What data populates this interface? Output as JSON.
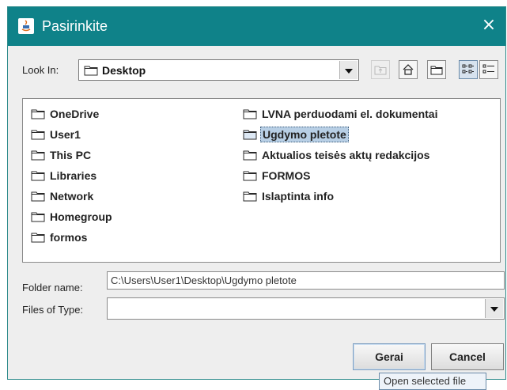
{
  "window": {
    "title": "Pasirinkite",
    "close_glyph": "×"
  },
  "look_in": {
    "label": "Look In:",
    "value": "Desktop"
  },
  "toolbar": {
    "icons": [
      "up-folder-icon",
      "home-icon",
      "new-folder-icon",
      "list-view-icon",
      "details-view-icon"
    ]
  },
  "files": [
    {
      "name": "OneDrive",
      "selected": false
    },
    {
      "name": "User1",
      "selected": false
    },
    {
      "name": "This PC",
      "selected": false
    },
    {
      "name": "Libraries",
      "selected": false
    },
    {
      "name": "Network",
      "selected": false
    },
    {
      "name": "Homegroup",
      "selected": false
    },
    {
      "name": "formos",
      "selected": false
    },
    {
      "name": "LVNA perduodami el. dokumentai",
      "selected": false
    },
    {
      "name": "Ugdymo pletote",
      "selected": true
    },
    {
      "name": "Aktualios teisės aktų redakcijos",
      "selected": false
    },
    {
      "name": "FORMOS",
      "selected": false
    },
    {
      "name": "Islaptinta info",
      "selected": false
    }
  ],
  "folder_name": {
    "label": "Folder name:",
    "value": "C:\\Users\\User1\\Desktop\\Ugdymo pletote"
  },
  "files_of_type": {
    "label": "Files of Type:",
    "value": ""
  },
  "buttons": {
    "ok": "Gerai",
    "cancel": "Cancel"
  },
  "tooltip": "Open selected file",
  "colors": {
    "titlebar": "#0f8289",
    "selection": "#b8cfe5",
    "background": "#eeeeee"
  }
}
